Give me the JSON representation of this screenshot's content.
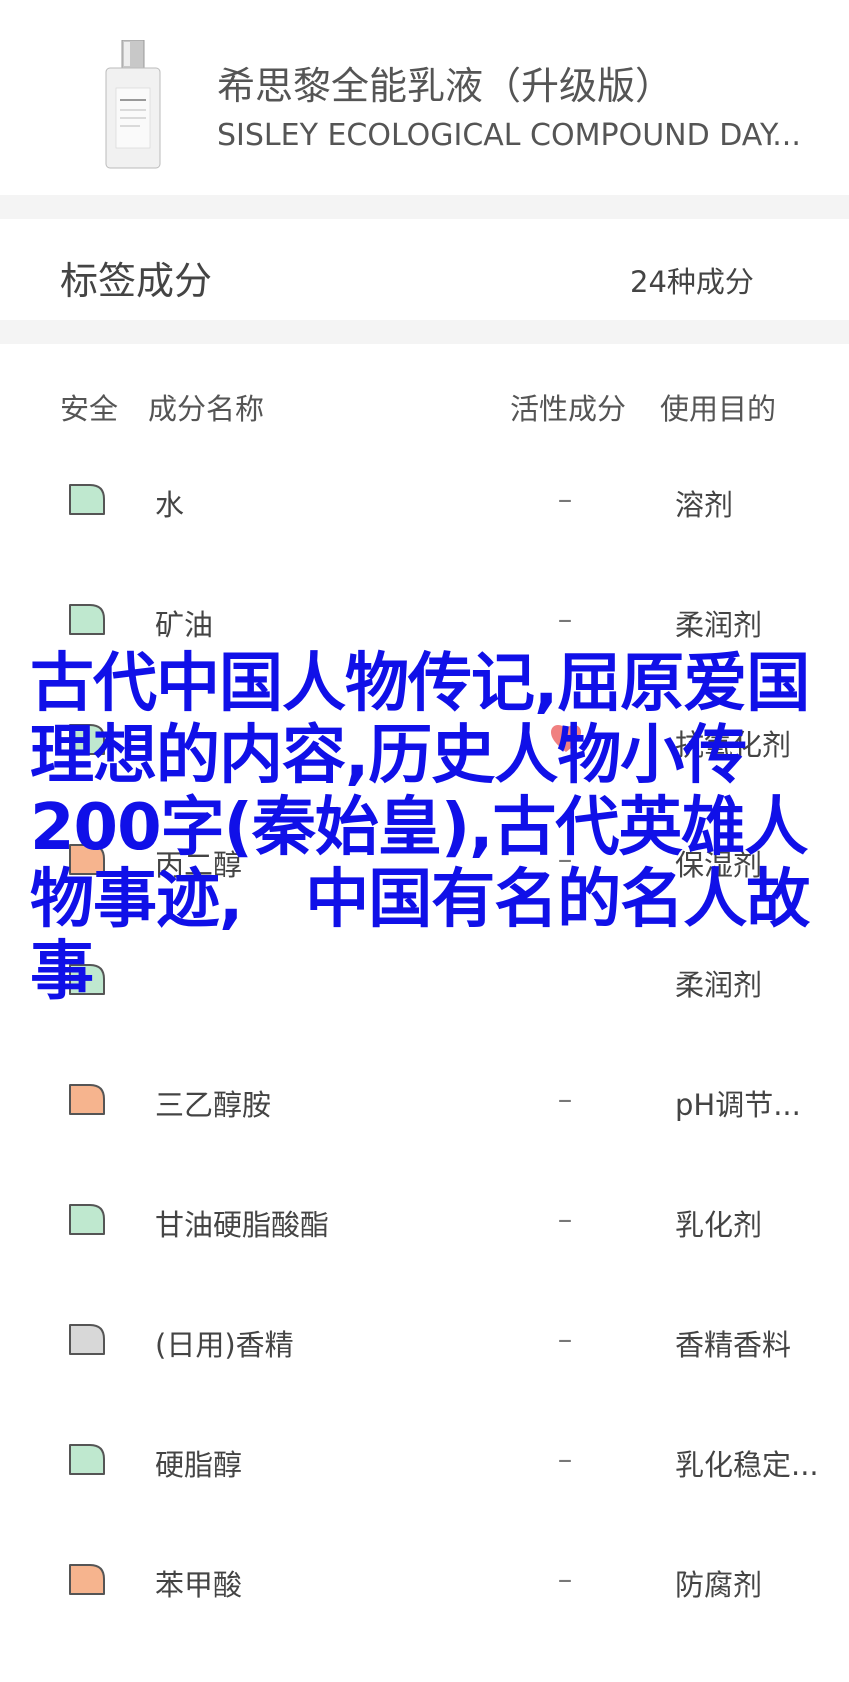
{
  "product": {
    "name_cn": "希思黎全能乳液（升级版）",
    "name_en": "SISLEY ECOLOGICAL COMPOUND DAY..."
  },
  "tags": {
    "title": "标签成分",
    "count": "24种成分"
  },
  "table": {
    "headers": {
      "safety": "安全",
      "name": "成分名称",
      "active": "活性成分",
      "purpose": "使用目的"
    },
    "rows": [
      {
        "safety": "green",
        "name": "水",
        "active": "–",
        "purpose": "溶剂"
      },
      {
        "safety": "green",
        "name": "矿油",
        "active": "–",
        "purpose": "柔润剂"
      },
      {
        "safety": "green",
        "name": "",
        "active": "",
        "purpose": "抗氧化剂"
      },
      {
        "safety": "orange",
        "name": "丙二醇",
        "active": "–",
        "purpose": "保湿剂"
      },
      {
        "safety": "green",
        "name": "",
        "active": "",
        "purpose": "柔润剂"
      },
      {
        "safety": "orange",
        "name": "三乙醇胺",
        "active": "–",
        "purpose": "pH调节..."
      },
      {
        "safety": "green",
        "name": "甘油硬脂酸酯",
        "active": "–",
        "purpose": "乳化剂"
      },
      {
        "safety": "gray",
        "name": "(日用)香精",
        "active": "–",
        "purpose": "香精香料"
      },
      {
        "safety": "green",
        "name": "硬脂醇",
        "active": "–",
        "purpose": "乳化稳定..."
      },
      {
        "safety": "orange",
        "name": "苯甲酸",
        "active": "–",
        "purpose": "防腐剂"
      }
    ]
  },
  "overlay_text": "古代中国人物传记,屈原爱国理想的内容,历史人物小传200字(秦始皇),古代英雄人物事迹,　中国有名的名人故事",
  "colors": {
    "green": "#bfe8cf",
    "orange": "#f6b48e",
    "gray": "#d8d8d8",
    "heart": "#f08080",
    "overlay": "#1010e8"
  }
}
